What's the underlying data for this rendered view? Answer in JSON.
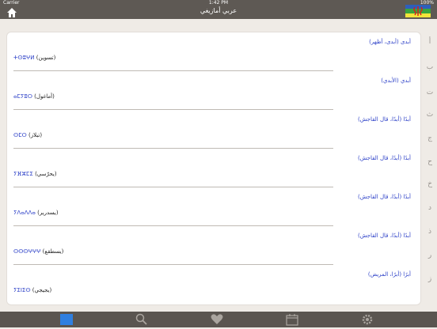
{
  "status": {
    "carrier": "Carrier",
    "time": "1:42 PM",
    "battery": "100%"
  },
  "nav": {
    "title": "عربي أمازيغي"
  },
  "flag_colors": [
    "#2e5fbb",
    "#3aa33d",
    "#f2e43a"
  ],
  "flag_symbol_color": "#d62020",
  "entries": [
    {
      "arabic": "أبدى (أبدى، أظهر)",
      "tifinagh": "ⵜⵙⵓⵖⵍ",
      "paren": "(تسوين)"
    },
    {
      "arabic": "أبدي (الأبدي)",
      "tifinagh": "ⴰⵎⵢⵓⵔ",
      "paren": "(أماغول)"
    },
    {
      "arabic": "أبدًا (أبدًا، قال القاجش)",
      "tifinagh": "ⵙⵎⵔ",
      "paren": "(تبلاز)"
    },
    {
      "arabic": "أبدًا (أبدًا، قال القاجش)",
      "tifinagh": "ⵢⴼⵣⵎⵉ",
      "paren": "(يحرّسي)"
    },
    {
      "arabic": "أبدًا (أبدًا، قال القاجش)",
      "tifinagh": "ⵢⴷⴰⴷⴷⴰ",
      "paren": "(يسدرير)"
    },
    {
      "arabic": "أبدًا (أبدًا، قال القاجش)",
      "tifinagh": "ⵙⵙⵙⵖⵖⵖ",
      "paren": "(يسطقع)"
    },
    {
      "arabic": "أبرًا (أبرًا، المريض)",
      "tifinagh": "ⵢⵉⵏⵉⵙ",
      "paren": "(يجيجي)"
    }
  ],
  "index_letters": [
    "أ",
    "ب",
    "ت",
    "ث",
    "ج",
    "ح",
    "خ",
    "د",
    "ذ",
    "ر",
    "ز"
  ],
  "accent": "#2b3fc7",
  "tabs": [
    "alphabet-tab",
    "search-tab",
    "favorites-tab",
    "calendar-tab",
    "settings-tab"
  ]
}
